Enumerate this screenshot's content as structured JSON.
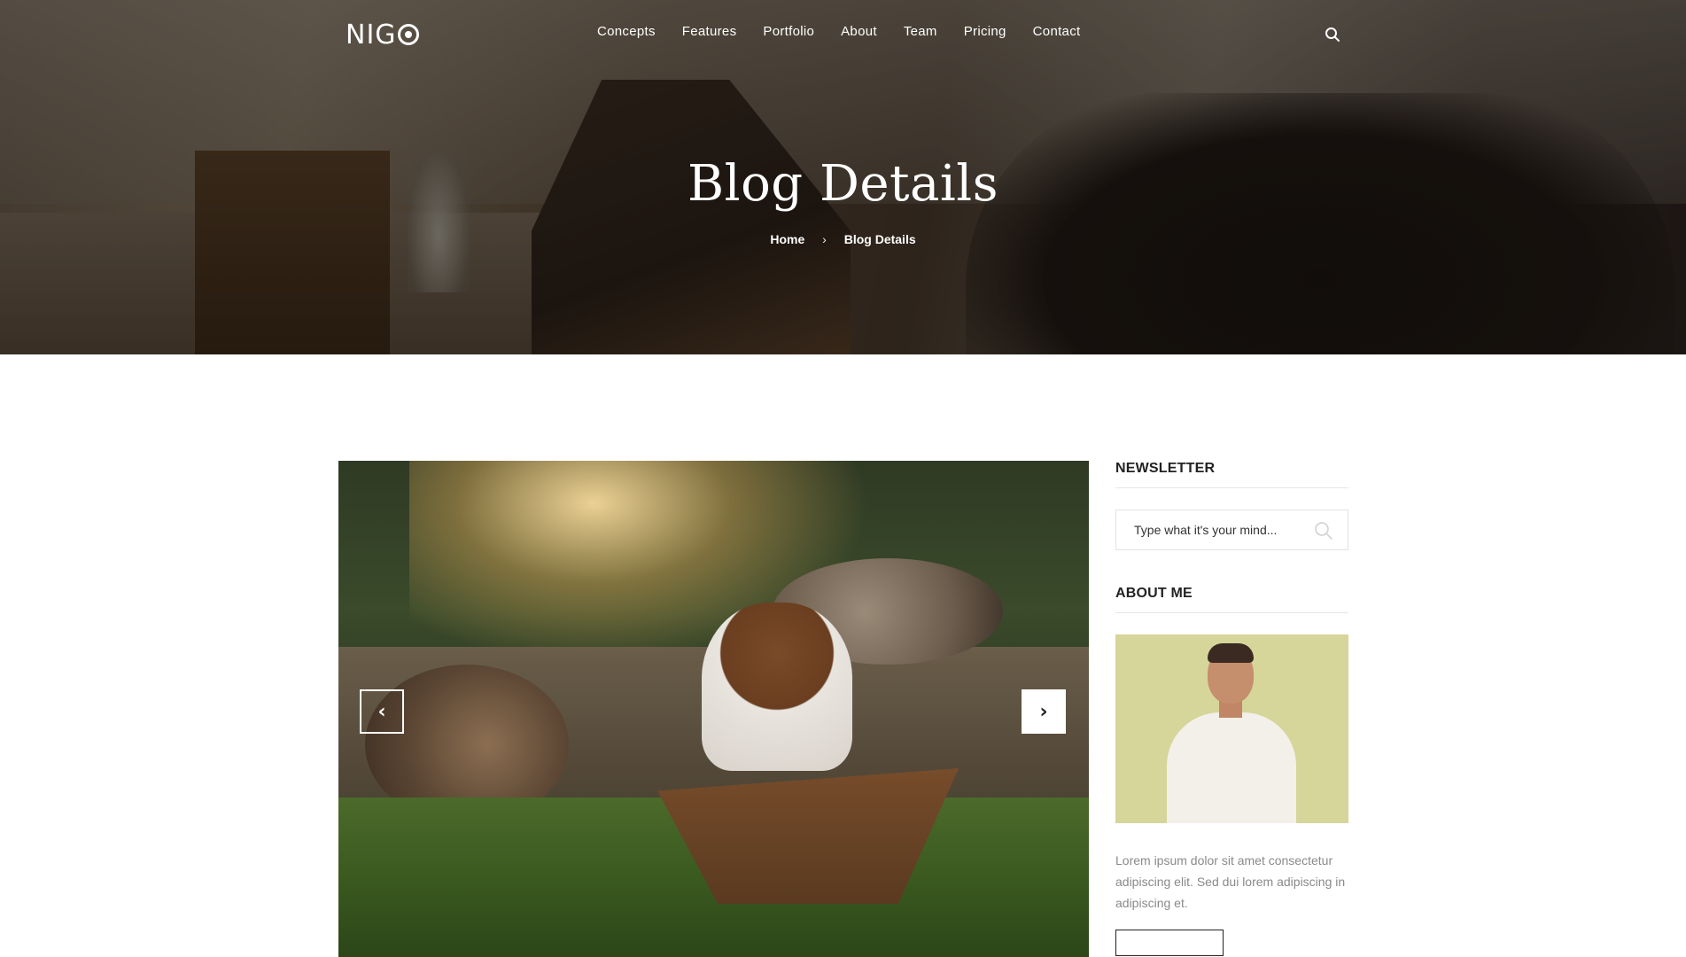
{
  "header": {
    "logo_text": "NIG",
    "nav": [
      "Concepts",
      "Features",
      "Portfolio",
      "About",
      "Team",
      "Pricing",
      "Contact"
    ],
    "search_icon": "search-icon"
  },
  "hero": {
    "title": "Blog Details",
    "breadcrumb": {
      "home": "Home",
      "separator": "›",
      "current": "Blog Details"
    }
  },
  "slider": {
    "prev_icon": "chevron-left-icon",
    "next_icon": "chevron-right-icon",
    "prev_glyph": "‹",
    "next_glyph": "›"
  },
  "sidebar": {
    "newsletter": {
      "title": "NEWSLETTER",
      "placeholder": "Type what it's your mind...",
      "icon": "search-icon"
    },
    "about": {
      "title": "ABOUT ME",
      "text": "Lorem ipsum dolor sit amet consectetur adipiscing elit. Sed dui lorem adipiscing in adipiscing et."
    }
  }
}
